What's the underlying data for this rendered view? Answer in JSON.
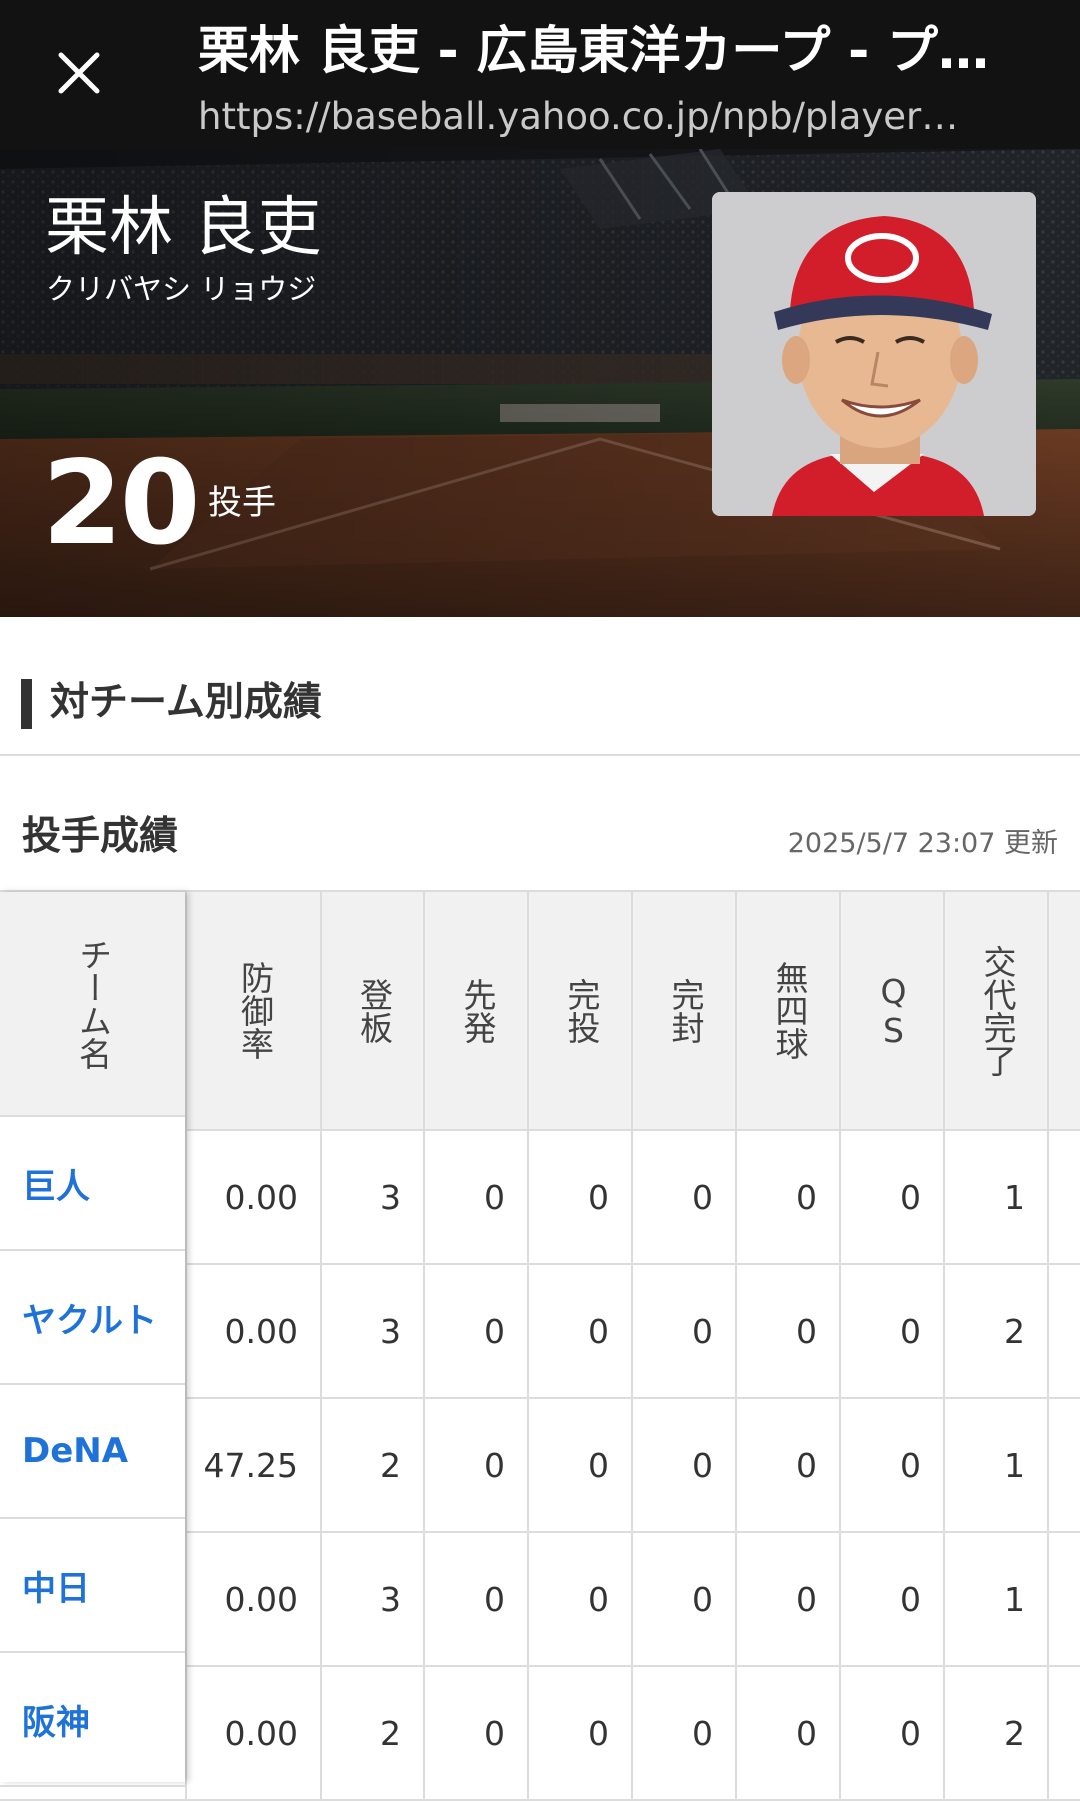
{
  "browser": {
    "title": "栗林 良吏 - 広島東洋カープ - プ…",
    "url": "https://baseball.yahoo.co.jp/npb/player…"
  },
  "player": {
    "name": "栗林 良吏",
    "kana": "クリバヤシ リョウジ",
    "number": "20",
    "position": "投手",
    "cap_color": "#d21e2b"
  },
  "section": {
    "title": "対チーム別成績"
  },
  "pitching": {
    "title": "投手成績",
    "updated": "2025/5/7 23:07 更新",
    "columns": [
      "チーム名",
      "防御率",
      "登板",
      "先発",
      "完投",
      "完封",
      "無四球",
      "QS",
      "交代完了"
    ],
    "rows": [
      {
        "team": "巨人",
        "values": [
          "0.00",
          "3",
          "0",
          "0",
          "0",
          "0",
          "0",
          "1"
        ]
      },
      {
        "team": "ヤクルト",
        "values": [
          "0.00",
          "3",
          "0",
          "0",
          "0",
          "0",
          "0",
          "2"
        ]
      },
      {
        "team": "DeNA",
        "values": [
          "47.25",
          "2",
          "0",
          "0",
          "0",
          "0",
          "0",
          "1"
        ]
      },
      {
        "team": "中日",
        "values": [
          "0.00",
          "3",
          "0",
          "0",
          "0",
          "0",
          "0",
          "1"
        ]
      },
      {
        "team": "阪神",
        "values": [
          "0.00",
          "2",
          "0",
          "0",
          "0",
          "0",
          "0",
          "2"
        ]
      }
    ]
  },
  "colors": {
    "link": "#1f72d8",
    "topbar": "#121212"
  }
}
